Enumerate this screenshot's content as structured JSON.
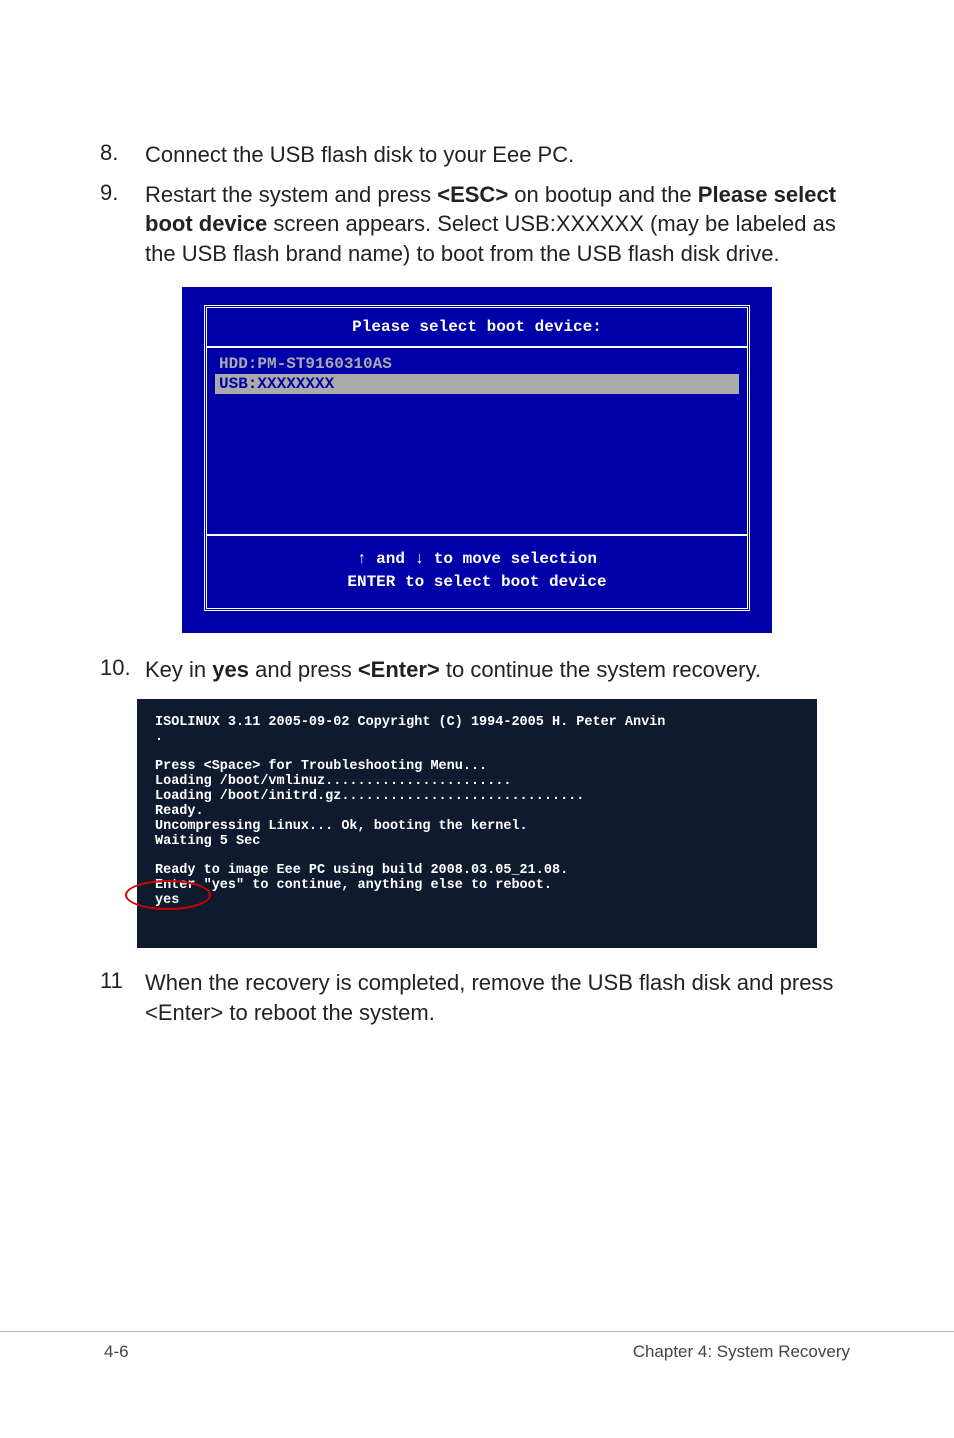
{
  "steps": {
    "s8": {
      "num": "8.",
      "text_a": "Connect the USB flash disk to your Eee PC."
    },
    "s9": {
      "num": "9.",
      "text_a": "Restart the system and press ",
      "bold_a": "<ESC>",
      "text_b": " on bootup and the ",
      "bold_b": "Please select boot device",
      "text_c": " screen appears. Select USB:XXXXXX (may be labeled as the USB flash brand name) to boot from the USB flash disk drive."
    },
    "s10": {
      "num": "10.",
      "text_a": "Key in ",
      "bold_a": "yes",
      "text_b": " and press ",
      "bold_b": "<Enter>",
      "text_c": " to continue the system recovery."
    },
    "s11": {
      "num": "11",
      "text_a": "When the recovery is completed, remove the USB flash disk and press <Enter> to reboot the system."
    }
  },
  "bios": {
    "title": "Please select boot device:",
    "item0": "HDD:PM-ST9160310AS",
    "item1": "USB:XXXXXXXX",
    "footer_line1": "↑ and ↓ to move selection",
    "footer_line2": "ENTER to select boot device"
  },
  "terminal": {
    "l1": "ISOLINUX 3.11 2005-09-02 Copyright (C) 1994-2005 H. Peter Anvin",
    "l2": ".",
    "l3": "Press <Space> for Troubleshooting Menu...",
    "l4": "Loading /boot/vmlinuz.......................",
    "l5": "Loading /boot/initrd.gz..............................",
    "l6": "Ready.",
    "l7": "Uncompressing Linux... Ok, booting the kernel.",
    "l8": "Waiting 5 Sec",
    "l9": "Ready to image Eee PC using build 2008.03.05_21.08.",
    "l10": "Enter \"yes\" to continue, anything else to reboot.",
    "l11": "yes"
  },
  "footer": {
    "left": "4-6",
    "right": "Chapter 4: System Recovery"
  }
}
